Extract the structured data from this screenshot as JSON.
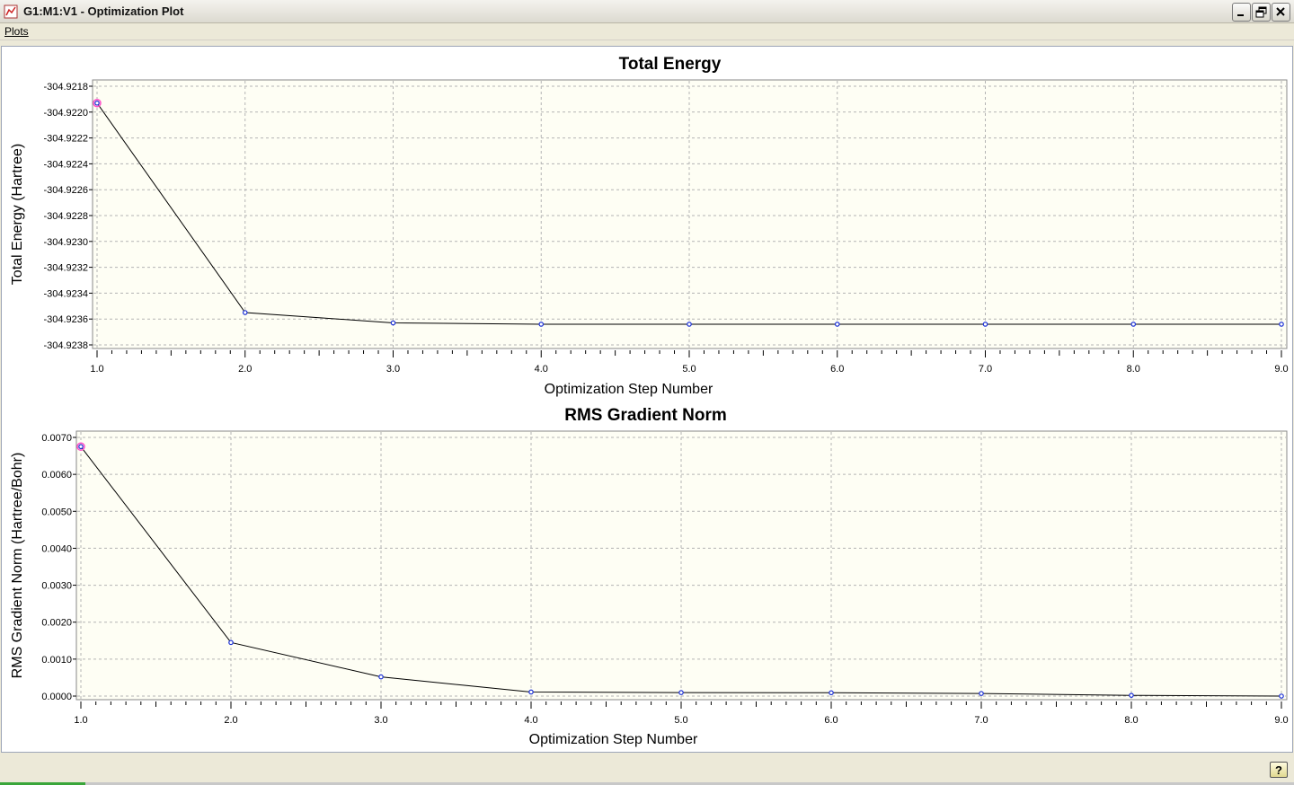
{
  "window": {
    "title": "G1:M1:V1 - Optimization Plot",
    "icons": [
      "app-icon",
      "minimize-icon",
      "restore-icon",
      "close-icon"
    ]
  },
  "menu": {
    "items": [
      {
        "label": "Plots"
      }
    ]
  },
  "status": {
    "help_icon": "help-icon"
  },
  "colors": {
    "plot_bg": "#fefef4",
    "line": "#000000",
    "marker": "#1a2fd6",
    "highlight": "#ff4fc8",
    "grid": "#b4b4b4"
  },
  "chart_data": [
    {
      "type": "line",
      "title": "Total Energy",
      "xlabel": "Optimization Step Number",
      "ylabel": "Total Energy (Hartree)",
      "x": [
        1,
        2,
        3,
        4,
        5,
        6,
        7,
        8,
        9
      ],
      "series": [
        {
          "values": [
            -304.92193,
            -304.92355,
            -304.92363,
            -304.92364,
            -304.92364,
            -304.92364,
            -304.92364,
            -304.92364,
            -304.92364
          ]
        }
      ],
      "xlim": [
        1,
        9
      ],
      "ylim": [
        -304.9238,
        -304.9218
      ],
      "xticks": [
        "1.0",
        "2.0",
        "3.0",
        "4.0",
        "5.0",
        "6.0",
        "7.0",
        "8.0",
        "9.0"
      ],
      "yticks": [
        "-304.9218",
        "-304.9220",
        "-304.9222",
        "-304.9224",
        "-304.9226",
        "-304.9228",
        "-304.9230",
        "-304.9232",
        "-304.9234",
        "-304.9236",
        "-304.9238"
      ],
      "grid": true,
      "highlighted_point": 0
    },
    {
      "type": "line",
      "title": "RMS Gradient Norm",
      "xlabel": "Optimization Step Number",
      "ylabel": "RMS Gradient Norm (Hartree/Bohr)",
      "x": [
        1,
        2,
        3,
        4,
        5,
        6,
        7,
        8,
        9
      ],
      "series": [
        {
          "values": [
            0.00675,
            0.00145,
            0.00052,
            0.00011,
            9.5e-05,
            9e-05,
            7e-05,
            2e-05,
            0.0
          ]
        }
      ],
      "xlim": [
        1,
        9
      ],
      "ylim": [
        0.0,
        0.007
      ],
      "xticks": [
        "1.0",
        "2.0",
        "3.0",
        "4.0",
        "5.0",
        "6.0",
        "7.0",
        "8.0",
        "9.0"
      ],
      "yticks": [
        "0.0070",
        "0.0060",
        "0.0050",
        "0.0040",
        "0.0030",
        "0.0020",
        "0.0010",
        "0.0000"
      ],
      "grid": true,
      "highlighted_point": 0
    }
  ]
}
